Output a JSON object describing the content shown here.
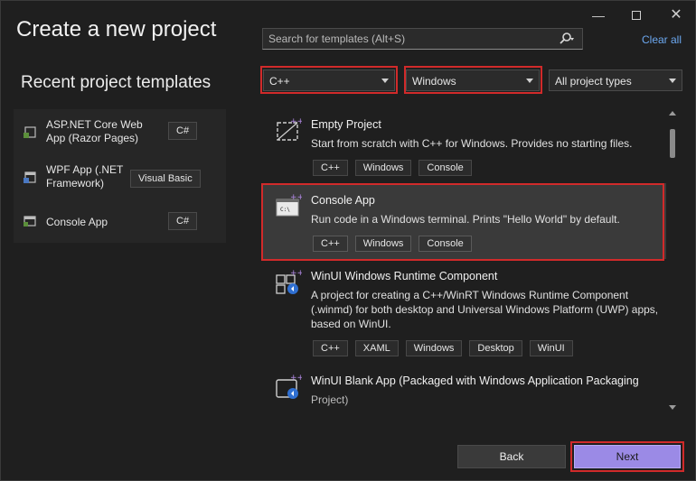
{
  "window": {
    "title": "Create a new project",
    "controls": {
      "minimize": "—",
      "close": "✕"
    }
  },
  "recent": {
    "heading": "Recent project templates",
    "items": [
      {
        "name": "ASP.NET Core Web App (Razor Pages)",
        "lang": "C#",
        "icon": "web-app-icon"
      },
      {
        "name": "WPF App (.NET Framework)",
        "lang": "Visual Basic",
        "icon": "wpf-app-icon"
      },
      {
        "name": "Console App",
        "lang": "C#",
        "icon": "console-app-icon"
      }
    ]
  },
  "search": {
    "placeholder": "Search for templates (Alt+S)",
    "clear_all": "Clear all"
  },
  "filters": {
    "language": "C++",
    "platform": "Windows",
    "project_type": "All project types"
  },
  "templates": [
    {
      "name": "Empty Project",
      "description": "Start from scratch with C++ for Windows. Provides no starting files.",
      "tags": [
        "C++",
        "Windows",
        "Console"
      ]
    },
    {
      "name": "Console App",
      "description": "Run code in a Windows terminal. Prints \"Hello World\" by default.",
      "tags": [
        "C++",
        "Windows",
        "Console"
      ],
      "icon_text": "C:\\"
    },
    {
      "name": "WinUI Windows Runtime Component",
      "description": "A project for creating a C++/WinRT Windows Runtime Component (.winmd) for both desktop and Universal Windows Platform (UWP) apps, based on WinUI.",
      "tags": [
        "C++",
        "XAML",
        "Windows",
        "Desktop",
        "WinUI"
      ]
    },
    {
      "name": "WinUI Blank App (Packaged with Windows Application Packaging",
      "description": "Project)"
    }
  ],
  "buttons": {
    "back": "Back",
    "next": "Next"
  },
  "colors": {
    "accent": "#9b8ae6",
    "highlight": "#d12a2a",
    "link": "#6ca8f0"
  }
}
